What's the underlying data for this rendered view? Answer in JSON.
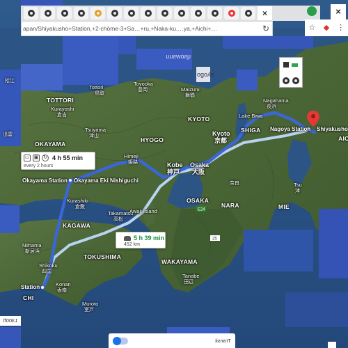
{
  "browser": {
    "url": "apan/Shiyakusho+Station,+2-chōme-3+Sa…+ru,+Naka-ku,…ya,+Aichi+…",
    "tab_count": 13,
    "close_glyph": "×"
  },
  "map": {
    "prefectures": [
      {
        "id": "tottori",
        "label": "TOTTORI"
      },
      {
        "id": "okayama",
        "label": "OKAYAMA"
      },
      {
        "id": "hyogo",
        "label": "HYOGO"
      },
      {
        "id": "kyoto",
        "label": "KYOTO"
      },
      {
        "id": "shiga",
        "label": "SHIGA"
      },
      {
        "id": "osaka",
        "label": "OSAKA"
      },
      {
        "id": "nara",
        "label": "NARA"
      },
      {
        "id": "mie",
        "label": "MIE"
      },
      {
        "id": "kagawa",
        "label": "KAGAWA"
      },
      {
        "id": "tokushima",
        "label": "TOKUSHIMA"
      },
      {
        "id": "wakayama",
        "label": "WAKAYAMA"
      },
      {
        "id": "aichi",
        "label": "AICHI"
      },
      {
        "id": "kochi",
        "label": "CHI"
      }
    ],
    "cities": [
      {
        "id": "tottori-city",
        "label": "Tottori"
      },
      {
        "id": "tottori-city-jp",
        "label": "鳥取"
      },
      {
        "id": "toyooka",
        "label": "Toyooka"
      },
      {
        "id": "toyooka-jp",
        "label": "豊岡"
      },
      {
        "id": "maizuru",
        "label": "Maizuru"
      },
      {
        "id": "maizuru-jp",
        "label": "舞鶴"
      },
      {
        "id": "kurayoshi",
        "label": "Kurayoshi"
      },
      {
        "id": "kurayoshi-jp",
        "label": "倉吉"
      },
      {
        "id": "tsuyama",
        "label": "Tsuyama"
      },
      {
        "id": "tsuyama-jp",
        "label": "津山"
      },
      {
        "id": "himeji",
        "label": "Himeji"
      },
      {
        "id": "himeji-jp",
        "label": "姫路"
      },
      {
        "id": "kobe",
        "label": "Kobe"
      },
      {
        "id": "kobe-jp",
        "label": "神戸"
      },
      {
        "id": "osaka-city",
        "label": "Osaka"
      },
      {
        "id": "osaka-city-jp",
        "label": "大阪"
      },
      {
        "id": "kyoto-city",
        "label": "Kyoto"
      },
      {
        "id": "kyoto-city-jp",
        "label": "京都"
      },
      {
        "id": "lake-biwa",
        "label": "Lake Biwa"
      },
      {
        "id": "nagahama",
        "label": "Nagahama"
      },
      {
        "id": "nagahama-jp",
        "label": "長浜"
      },
      {
        "id": "tsu",
        "label": "Tsu"
      },
      {
        "id": "tsu-jp",
        "label": "津"
      },
      {
        "id": "nara-jp",
        "label": "奈良"
      },
      {
        "id": "kurashiki",
        "label": "Kurashiki"
      },
      {
        "id": "kurashiki-jp",
        "label": "倉敷"
      },
      {
        "id": "takamatsu",
        "label": "Takamatsu"
      },
      {
        "id": "takamatsu-jp",
        "label": "高松"
      },
      {
        "id": "niihama",
        "label": "Niihama"
      },
      {
        "id": "niihama-jp",
        "label": "新居浜"
      },
      {
        "id": "shikoku",
        "label": "Shikoku"
      },
      {
        "id": "shikoku-jp",
        "label": "四国"
      },
      {
        "id": "konan",
        "label": "Konan"
      },
      {
        "id": "konan-jp",
        "label": "香南"
      },
      {
        "id": "muroto",
        "label": "Muroto"
      },
      {
        "id": "muroto-jp",
        "label": "室戸"
      },
      {
        "id": "tanabe",
        "label": "Tanabe"
      },
      {
        "id": "tanabe-jp",
        "label": "田辺"
      },
      {
        "id": "awaji-island",
        "label": "Awaji Island"
      },
      {
        "id": "matsue-frag",
        "label": "松江"
      },
      {
        "id": "izumo-frag",
        "label": "出雲"
      }
    ],
    "stations": [
      {
        "id": "okayama-station",
        "label": "Okayama Station"
      },
      {
        "id": "okayama-eki-nishiguchi",
        "label": "Okayama Eki Nishiguchi"
      },
      {
        "id": "nagoya-station",
        "label": "Nagoya Station"
      },
      {
        "id": "shiyakusho",
        "label": "Shiyakusho"
      },
      {
        "id": "kochi-station",
        "label": "Station"
      }
    ],
    "road_shields": [
      "25",
      "E24"
    ],
    "mirrored_fragments": [
      "ɥsowsuu",
      "ogoʎɐ"
    ]
  },
  "routes": {
    "transit": {
      "time": "4 h 55 min",
      "frequency": "every 2 hours",
      "color": "#3b66d6"
    },
    "drive": {
      "time": "5 h 39 min",
      "distance": "452 km",
      "color": "#b9d3f2"
    }
  },
  "footer": {
    "layer_label": "Transit",
    "scale_label": "1300ft"
  },
  "colors": {
    "land": "#4e6a3a",
    "sea": "#2c5585",
    "glitch_blue": "#3657b8",
    "accent_blue": "#1a73e8",
    "pin_red": "#e53935"
  }
}
